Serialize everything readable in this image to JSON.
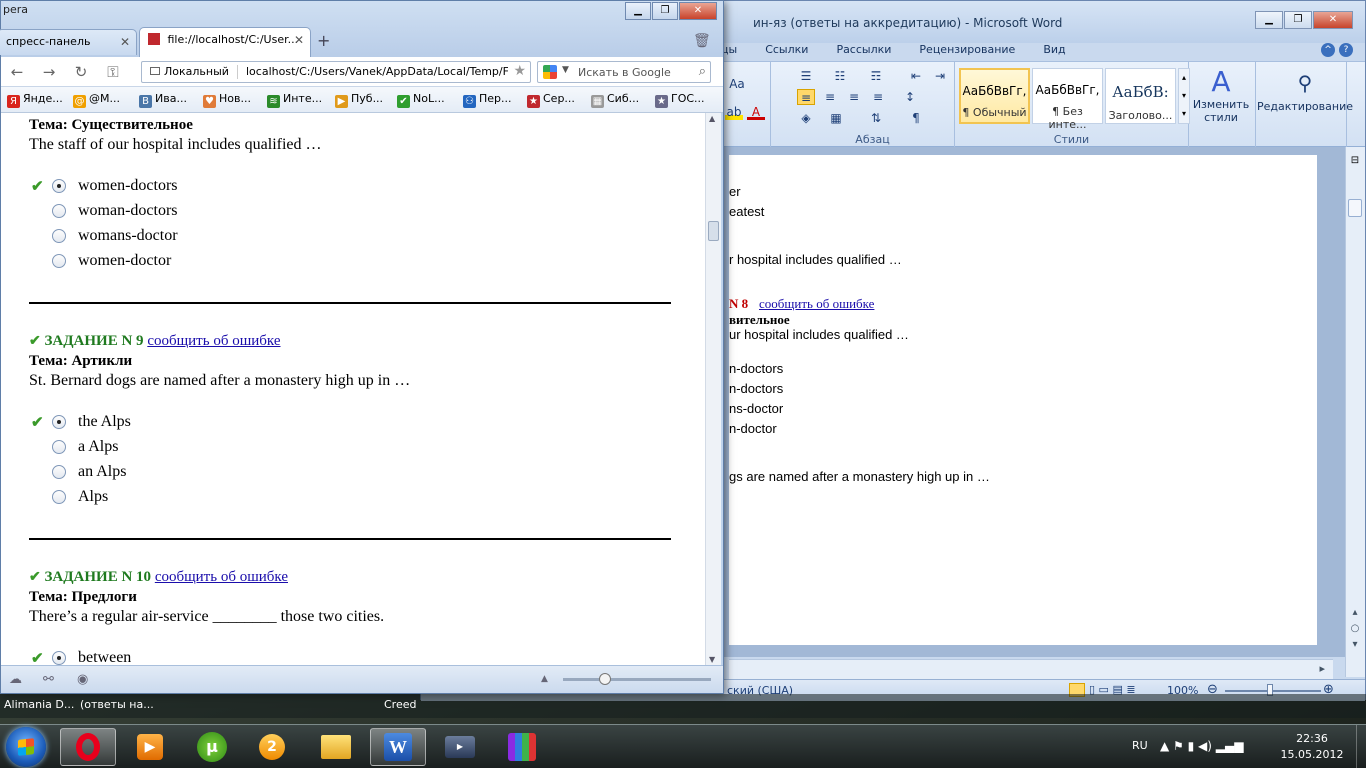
{
  "word": {
    "title": "ин-яз (ответы на аккредитацию)  -  Microsoft Word",
    "tabs": [
      "цы",
      "Ссылки",
      "Рассылки",
      "Рецензирование",
      "Вид"
    ],
    "groups": {
      "paragraph": "Абзац",
      "styles": "Стили"
    },
    "styles": [
      {
        "preview": "АаБбВвГг,",
        "name": "¶ Обычный"
      },
      {
        "preview": "АаБбВвГг,",
        "name": "¶ Без инте..."
      },
      {
        "preview": "АаБбВ:",
        "name": "Заголово..."
      }
    ],
    "change_styles": "Изменить стили",
    "editing": "Редактирование",
    "font_size_label": "Aa",
    "page_lines": [
      {
        "text": "er",
        "font": "sans"
      },
      {
        "text": "eatest",
        "font": "sans"
      },
      {
        "text": "r hospital includes qualified …",
        "font": "sans"
      },
      {
        "text": "N 8",
        "font": "serif-red"
      },
      {
        "text": "сообщить об ошибке",
        "font": "serif-link"
      },
      {
        "text": "вительное",
        "font": "serif-bold"
      },
      {
        "text": "ur hospital includes qualified …",
        "font": "sans"
      },
      {
        "text": "n-doctors",
        "font": "sans"
      },
      {
        "text": "n-doctors",
        "font": "sans"
      },
      {
        "text": "ns-doctor",
        "font": "sans"
      },
      {
        "text": "n-doctor",
        "font": "sans"
      },
      {
        "text": "gs are named after a monastery high up in …",
        "font": "sans"
      }
    ],
    "status_lang": "ский (США)",
    "zoom": "100%"
  },
  "browser": {
    "app_label": "pera",
    "tabs": [
      {
        "label": "спресс-панель"
      },
      {
        "label": "file://localhost/C:/User..."
      }
    ],
    "address_mode": "Локальный",
    "url": "localhost/C:/Users/Vanek/AppData/Local/Temp/F",
    "search_placeholder": "Искать в Google",
    "bookmarks": [
      {
        "label": "Янде...",
        "color": "#d9251d",
        "glyph": "Я"
      },
      {
        "label": "@M...",
        "color": "#f0a000",
        "glyph": "@"
      },
      {
        "label": "Ива...",
        "color": "#4a76a8",
        "glyph": "B"
      },
      {
        "label": "Нов...",
        "color": "#e07b39",
        "glyph": "♥"
      },
      {
        "label": "Инте...",
        "color": "#2a8a2a",
        "glyph": "≋"
      },
      {
        "label": "Пуб...",
        "color": "#e09a1b",
        "glyph": "▶"
      },
      {
        "label": "NoL...",
        "color": "#2f9e2f",
        "glyph": "✔"
      },
      {
        "label": "Пер...",
        "color": "#2366c0",
        "glyph": "⚇"
      },
      {
        "label": "Сер...",
        "color": "#c0282e",
        "glyph": "★"
      },
      {
        "label": "Сиб...",
        "color": "#999999",
        "glyph": "▦"
      },
      {
        "label": "ГОС...",
        "color": "#6a6a8a",
        "glyph": "★"
      }
    ],
    "content": {
      "q8": {
        "topic": "Тема: Существительное",
        "question": "The staff of our hospital includes qualified …",
        "options": [
          "women-doctors",
          "woman-doctors",
          "womans-doctor",
          "women-doctor"
        ],
        "selected": 0
      },
      "q9": {
        "task": "ЗАДАНИЕ N 9",
        "report": "сообщить об ошибке",
        "topic": "Тема: Артикли",
        "question": "St. Bernard dogs are named after a monastery high up in …",
        "options": [
          "the Alps",
          "a Alps",
          "an Alps",
          "Alps"
        ],
        "selected": 0
      },
      "q10": {
        "task": "ЗАДАНИЕ N 10",
        "report": "сообщить об ошибке",
        "topic": "Тема: Предлоги",
        "question": "There’s a regular air-service ________ those two cities.",
        "options": [
          "between"
        ],
        "selected": 0
      }
    }
  },
  "taskstrip": [
    "Alimania D...",
    "(ответы на...",
    "Creed"
  ],
  "taskbar": {
    "lang": "RU",
    "time": "22:36",
    "date": "15.05.2012"
  }
}
